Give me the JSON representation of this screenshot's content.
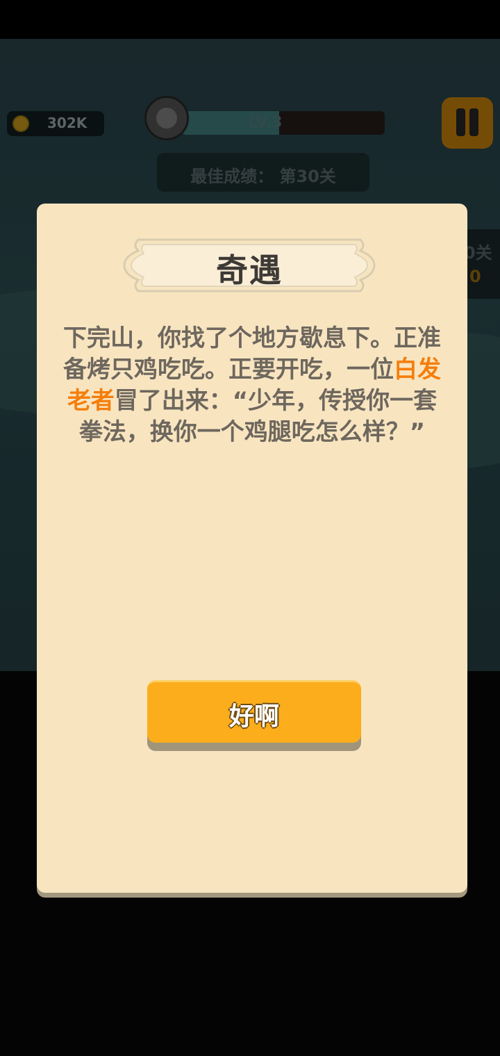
{
  "hud": {
    "coins": "302K",
    "level": "LV.3",
    "level_progress": 0.48,
    "best_score": "最佳成绩： 第30关",
    "side_label": "0关",
    "side_value": "0"
  },
  "dialog": {
    "title": "奇遇",
    "story_before": "下完山，你找了个地方歇息下。正准备烤只鸡吃吃。正要开吃，一位",
    "story_highlight": "白发老者",
    "story_after": "冒了出来：“少年，传授你一套拳法，换你一个鸡腿吃怎么样？”",
    "confirm_label": "好啊"
  },
  "colors": {
    "panel": "#f8e5c0",
    "button": "#fbad1c",
    "highlight": "#f57e0b",
    "body_text": "#6e675e"
  },
  "icons": [
    "coin-icon",
    "avatar-icon",
    "pause-icon"
  ]
}
